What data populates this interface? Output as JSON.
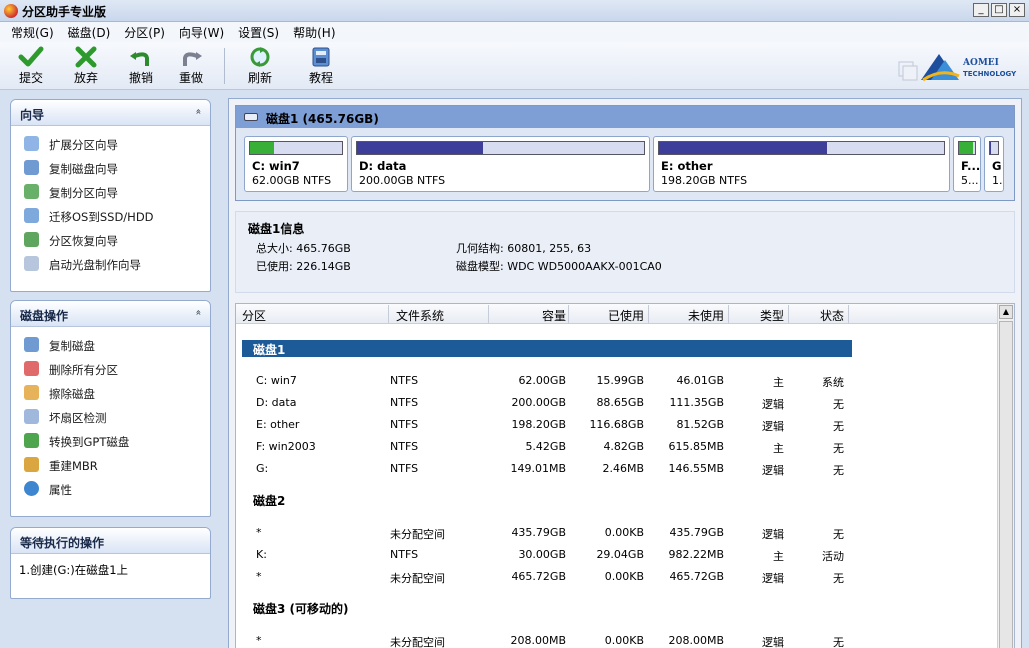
{
  "window": {
    "title": "分区助手专业版",
    "buttons": {
      "minimize": "_",
      "maximize": "□",
      "close": "×"
    }
  },
  "menu": [
    "常规(G)",
    "磁盘(D)",
    "分区(P)",
    "向导(W)",
    "设置(S)",
    "帮助(H)"
  ],
  "toolbar": {
    "commit": "提交",
    "discard": "放弃",
    "undo": "撤销",
    "redo": "重做",
    "refresh": "刷新",
    "tutorial": "教程",
    "logo_line1": "AOMEI",
    "logo_line2": "TECHNOLOGY"
  },
  "wizard_panel": {
    "title": "向导",
    "collapse": "«",
    "items": [
      "扩展分区向导",
      "复制磁盘向导",
      "复制分区向导",
      "迁移OS到SSD/HDD",
      "分区恢复向导",
      "启动光盘制作向导"
    ]
  },
  "disk_ops_panel": {
    "title": "磁盘操作",
    "collapse": "«",
    "items": [
      "复制磁盘",
      "删除所有分区",
      "擦除磁盘",
      "坏扇区检测",
      "转换到GPT磁盘",
      "重建MBR",
      "属性"
    ]
  },
  "pending_panel": {
    "title": "等待执行的操作",
    "items": [
      "1.创建(G:)在磁盘1上"
    ]
  },
  "disk_map": {
    "title": "磁盘1 (465.76GB)",
    "partitions": [
      {
        "name": "C: win7",
        "size": "62.00GB NTFS",
        "used_fraction": 0.26,
        "color": "#38b038"
      },
      {
        "name": "D: data",
        "size": "200.00GB NTFS",
        "used_fraction": 0.44,
        "color": "#3d3d9a"
      },
      {
        "name": "E: other",
        "size": "198.20GB NTFS",
        "used_fraction": 0.59,
        "color": "#3d3d9a"
      },
      {
        "name": "F...",
        "size": "5...",
        "used_fraction": 0.89,
        "color": "#38b038"
      },
      {
        "name": "G",
        "size": "1.",
        "used_fraction": 0.02,
        "color": "#3d3d9a"
      }
    ]
  },
  "disk_info": {
    "title": "磁盘1信息",
    "total_label": "总大小: 465.76GB",
    "used_label": "已使用: 226.14GB",
    "geometry_label": "几何结构: 60801, 255, 63",
    "model_label": "磁盘模型: WDC WD5000AAKX-001CA0"
  },
  "table": {
    "headers": [
      "分区",
      "文件系统",
      "容量",
      "已使用",
      "未使用",
      "类型",
      "状态"
    ],
    "groups": [
      {
        "title": "磁盘1",
        "rows": [
          [
            "C: win7",
            "NTFS",
            "62.00GB",
            "15.99GB",
            "46.01GB",
            "主",
            "系统"
          ],
          [
            "D: data",
            "NTFS",
            "200.00GB",
            "88.65GB",
            "111.35GB",
            "逻辑",
            "无"
          ],
          [
            "E: other",
            "NTFS",
            "198.20GB",
            "116.68GB",
            "81.52GB",
            "逻辑",
            "无"
          ],
          [
            "F: win2003",
            "NTFS",
            "5.42GB",
            "4.82GB",
            "615.85MB",
            "主",
            "无"
          ],
          [
            "G:",
            "NTFS",
            "149.01MB",
            "2.46MB",
            "146.55MB",
            "逻辑",
            "无"
          ]
        ]
      },
      {
        "title": "磁盘2",
        "rows": [
          [
            "*",
            "未分配空间",
            "435.79GB",
            "0.00KB",
            "435.79GB",
            "逻辑",
            "无"
          ],
          [
            "K:",
            "NTFS",
            "30.00GB",
            "29.04GB",
            "982.22MB",
            "主",
            "活动"
          ],
          [
            "*",
            "未分配空间",
            "465.72GB",
            "0.00KB",
            "465.72GB",
            "逻辑",
            "无"
          ]
        ]
      },
      {
        "title": "磁盘3 (可移动的)",
        "rows": [
          [
            "*",
            "未分配空间",
            "208.00MB",
            "0.00KB",
            "208.00MB",
            "逻辑",
            "无"
          ]
        ]
      }
    ]
  }
}
